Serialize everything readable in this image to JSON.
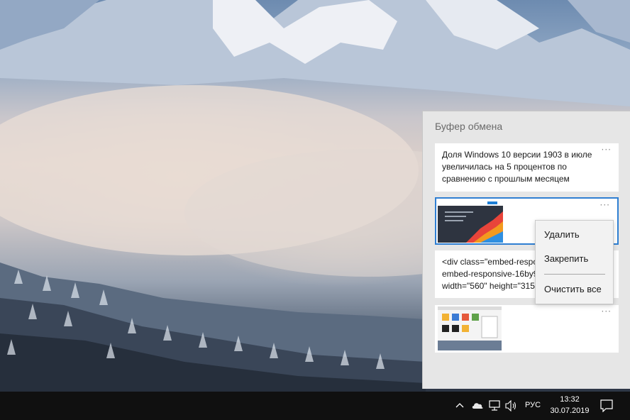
{
  "clipboard": {
    "title": "Буфер обмена",
    "items": [
      {
        "type": "text",
        "text": "Доля Windows 10 версии 1903 в июле увеличилась на 5 процентов по сравнению с прошлым месяцем",
        "more": "···"
      },
      {
        "type": "image",
        "more": "···"
      },
      {
        "type": "text",
        "text": "<div class=\"embed-responsive\nembed-responsive-16by9\nwidth=\"560\" height=\"315\"",
        "more": "···"
      },
      {
        "type": "image",
        "more": "···"
      }
    ]
  },
  "context_menu": {
    "delete": "Удалить",
    "pin": "Закрепить",
    "clear_all": "Очистить все"
  },
  "taskbar": {
    "language": "РУС",
    "time": "13:32",
    "date": "30.07.2019",
    "icons": [
      "chevron-up-icon",
      "onedrive-cloud-icon",
      "network-icon",
      "volume-icon",
      "notification-icon"
    ]
  }
}
